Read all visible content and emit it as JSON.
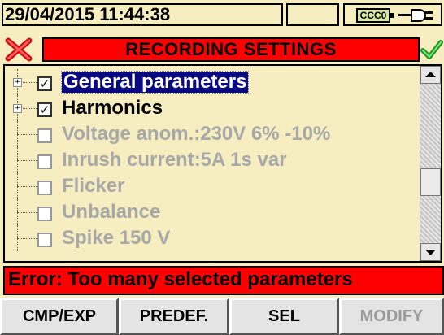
{
  "status": {
    "datetime": "29/04/2015 11:44:38",
    "battery_label": "CCC0",
    "battery_icon": "battery-icon",
    "power_icon": "plug-icon"
  },
  "header": {
    "title": "RECORDING SETTINGS",
    "close_icon": "close-icon",
    "confirm_icon": "checkmark-icon"
  },
  "tree": {
    "items": [
      {
        "label": "General parameters",
        "checked": true,
        "expandable": true,
        "selected": true
      },
      {
        "label": "Harmonics",
        "checked": true,
        "expandable": true,
        "selected": false
      },
      {
        "label": "Voltage anom.:230V 6% -10%",
        "checked": false,
        "expandable": false,
        "selected": false
      },
      {
        "label": "Inrush current:5A 1s var",
        "checked": false,
        "expandable": false,
        "selected": false
      },
      {
        "label": "Flicker",
        "checked": false,
        "expandable": false,
        "selected": false
      },
      {
        "label": "Unbalance",
        "checked": false,
        "expandable": false,
        "selected": false
      },
      {
        "label": "Spike 150 V",
        "checked": false,
        "expandable": false,
        "selected": false
      }
    ]
  },
  "error": {
    "message": "Error: Too many selected parameters"
  },
  "softkeys": [
    {
      "label": "CMP/EXP",
      "enabled": true
    },
    {
      "label": "PREDEF.",
      "enabled": true
    },
    {
      "label": "SEL",
      "enabled": true
    },
    {
      "label": "MODIFY",
      "enabled": false
    }
  ],
  "colors": {
    "background": "#f6edc0",
    "alert": "#ff0000",
    "selection": "#0a0a80"
  }
}
